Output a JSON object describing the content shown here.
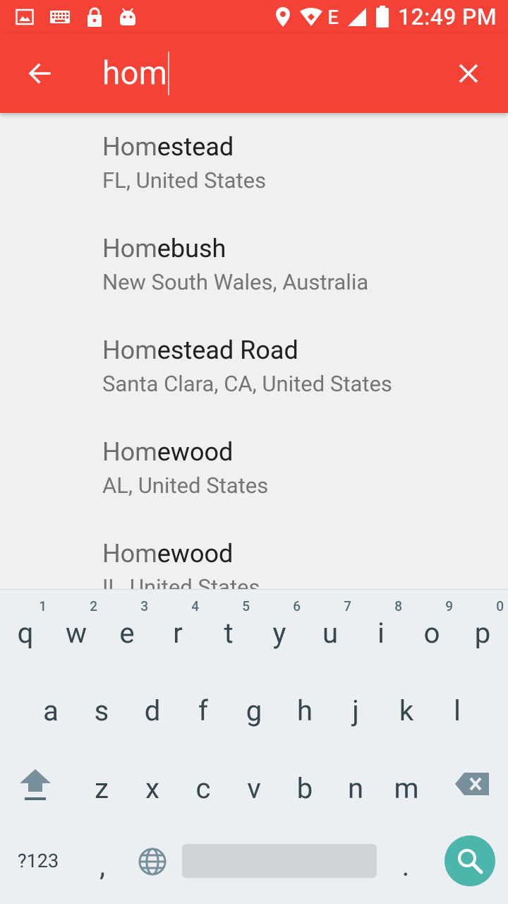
{
  "status_bar": {
    "time": "12:49 PM",
    "network_type": "E",
    "icons": [
      "image-icon",
      "keyboard-icon",
      "lock-icon",
      "android-icon",
      "location-icon",
      "wifi-icon",
      "signal-icon",
      "battery-icon"
    ]
  },
  "app_bar": {
    "color": "#f44336",
    "search_query": "hom",
    "back_icon": "arrow-back-icon",
    "clear_icon": "close-icon"
  },
  "suggestions": [
    {
      "match": "Hom",
      "rest": "estead",
      "subtitle": "FL, United States"
    },
    {
      "match": "Hom",
      "rest": "ebush",
      "subtitle": "New South Wales, Australia"
    },
    {
      "match": "Hom",
      "rest": "estead Road",
      "subtitle": "Santa Clara, CA, United States"
    },
    {
      "match": "Hom",
      "rest": "ewood",
      "subtitle": "AL, United States"
    },
    {
      "match": "Hom",
      "rest": "ewood",
      "subtitle": "IL, United States"
    }
  ],
  "keyboard": {
    "row1": [
      {
        "key": "q",
        "hint": "1"
      },
      {
        "key": "w",
        "hint": "2"
      },
      {
        "key": "e",
        "hint": "3"
      },
      {
        "key": "r",
        "hint": "4"
      },
      {
        "key": "t",
        "hint": "5"
      },
      {
        "key": "y",
        "hint": "6"
      },
      {
        "key": "u",
        "hint": "7"
      },
      {
        "key": "i",
        "hint": "8"
      },
      {
        "key": "o",
        "hint": "9"
      },
      {
        "key": "p",
        "hint": "0"
      }
    ],
    "row2": [
      "a",
      "s",
      "d",
      "f",
      "g",
      "h",
      "j",
      "k",
      "l"
    ],
    "row3": [
      "z",
      "x",
      "c",
      "v",
      "b",
      "n",
      "m"
    ],
    "symbols_label": "?123",
    "comma": ",",
    "period": ".",
    "action_color": "#4db6ac"
  }
}
